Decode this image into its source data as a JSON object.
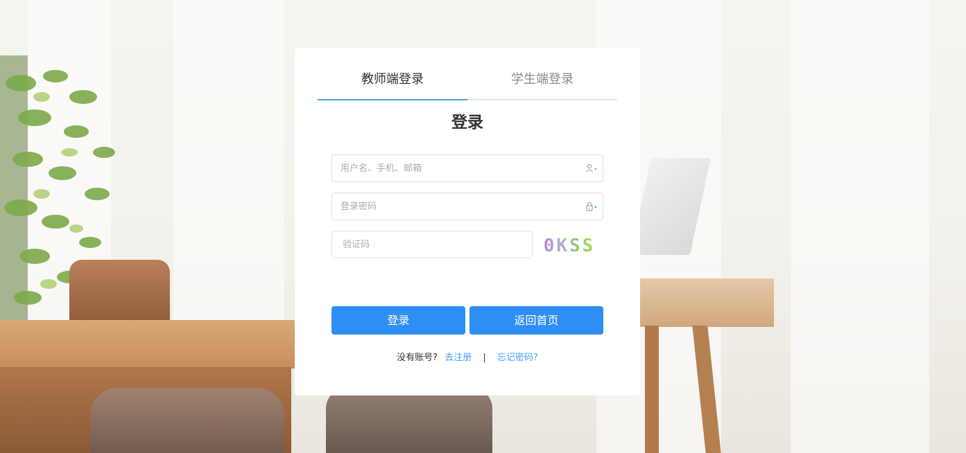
{
  "tabs": {
    "teacher": "教师端登录",
    "student": "学生端登录"
  },
  "form": {
    "title": "登录",
    "username_placeholder": "用户名、手机、邮箱",
    "password_placeholder": "登录密码",
    "captcha_placeholder": "验证码",
    "captcha_text": "0KSS"
  },
  "buttons": {
    "login": "登录",
    "home": "返回首页"
  },
  "footer": {
    "no_account": "没有账号?",
    "register": "去注册",
    "separator": "|",
    "forgot": "忘记密码?"
  },
  "colors": {
    "accent": "#2e8ef4",
    "link": "#409eff"
  },
  "icons": {
    "username": "user-icon",
    "password": "lock-icon"
  }
}
